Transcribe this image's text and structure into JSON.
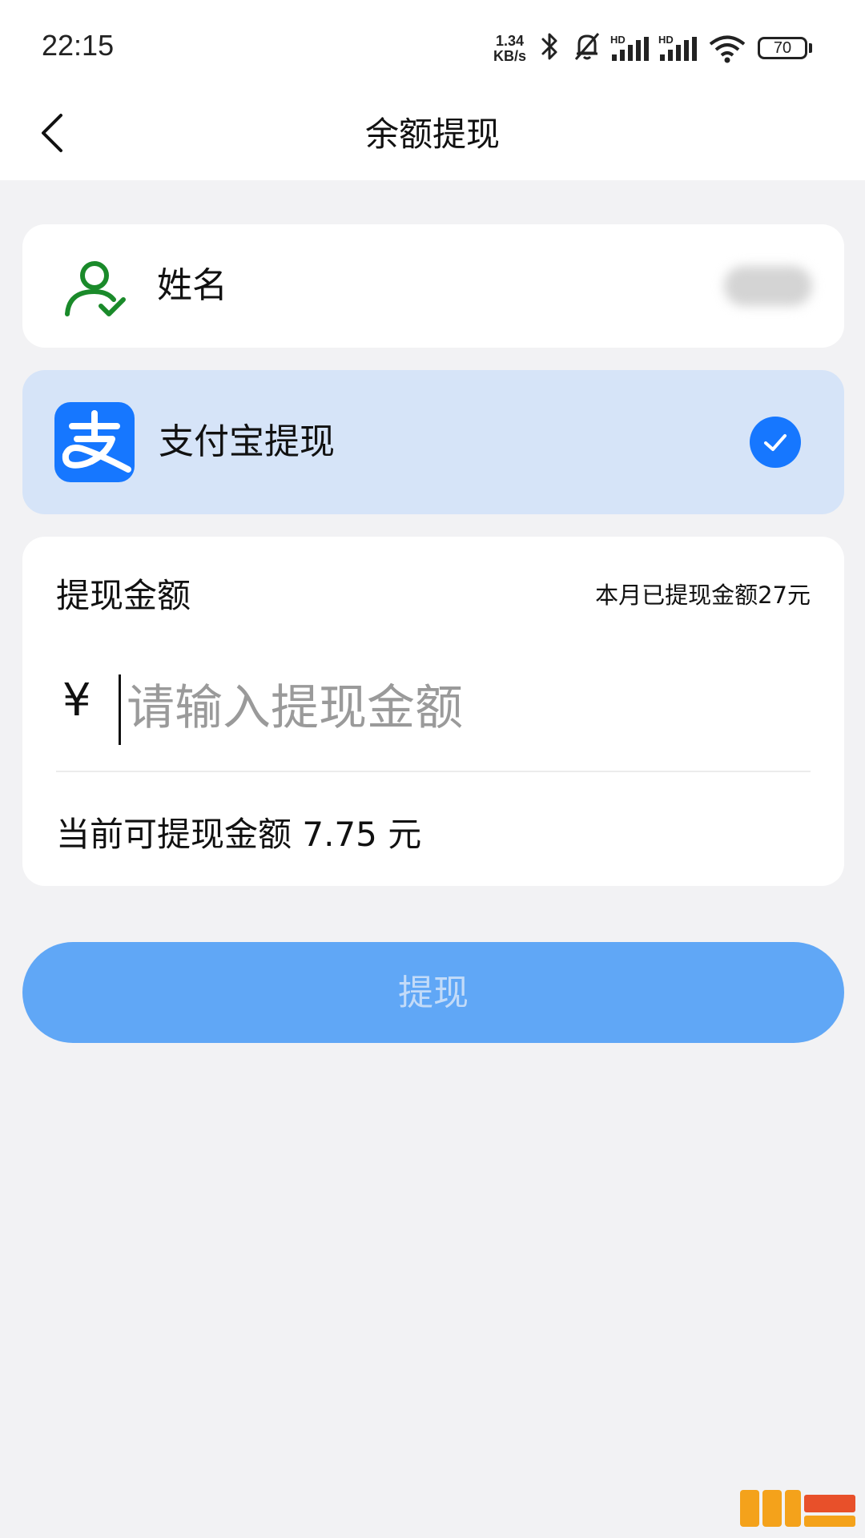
{
  "status_bar": {
    "time": "22:15",
    "speed_value": "1.34",
    "speed_unit": "KB/s",
    "network_label_1": "HD",
    "network_label_2": "HD",
    "battery": "70",
    "icons": [
      "bluetooth-icon",
      "bell-muted-icon",
      "signal-icon",
      "signal-icon",
      "wifi-icon",
      "battery-icon"
    ]
  },
  "header": {
    "title": "余额提现",
    "back_icon": "chevron-left-icon"
  },
  "name_row": {
    "label": "姓名",
    "icon": "user-check-icon",
    "icon_color": "#1a8a2a"
  },
  "payment_method": {
    "label": "支付宝提现",
    "icon": "alipay-logo-icon",
    "selected": true,
    "accent": "#1677ff"
  },
  "amount": {
    "title": "提现金额",
    "monthly_note": "本月已提现金额27元",
    "currency_symbol": "¥",
    "placeholder": "请输入提现金额",
    "available_text": "当前可提现金额 7.75 元"
  },
  "submit": {
    "label": "提现",
    "color": "#60a7f6"
  }
}
